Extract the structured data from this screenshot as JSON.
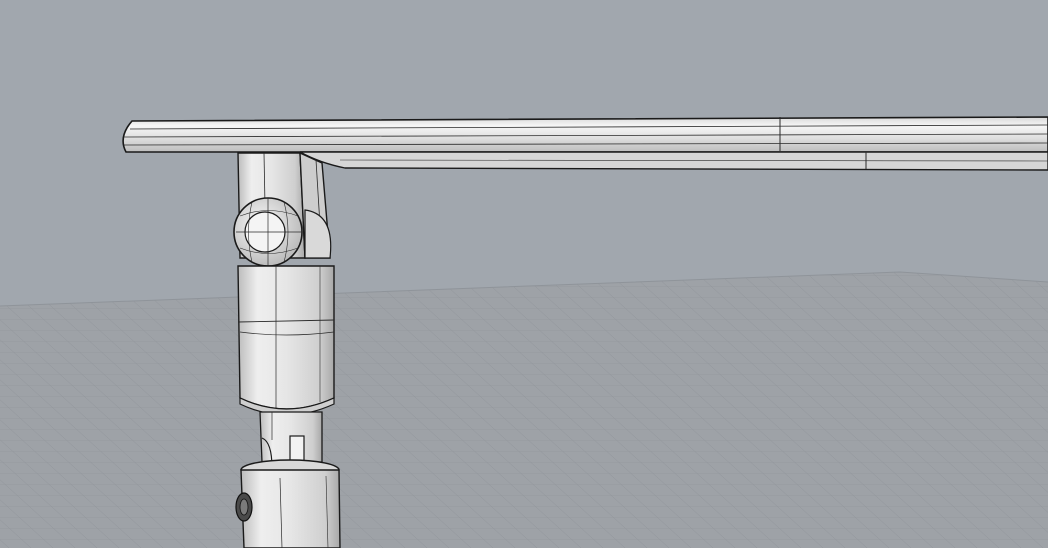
{
  "viewport": {
    "background_color": "#a1a7ae",
    "ground_color": "#9ea2a7",
    "grid_line_color": "#8c9096",
    "model_fill_color": "#e8e8e8",
    "model_edge_color": "#1a1a1a",
    "display_mode": "shaded-with-wireframe"
  },
  "model": {
    "parts": [
      "handlebar-tube",
      "clamp-block",
      "ball-joint",
      "upper-stem-sleeve",
      "lower-stem-tube"
    ],
    "icons": [
      "ball-joint-icon",
      "bolt-icon"
    ]
  }
}
